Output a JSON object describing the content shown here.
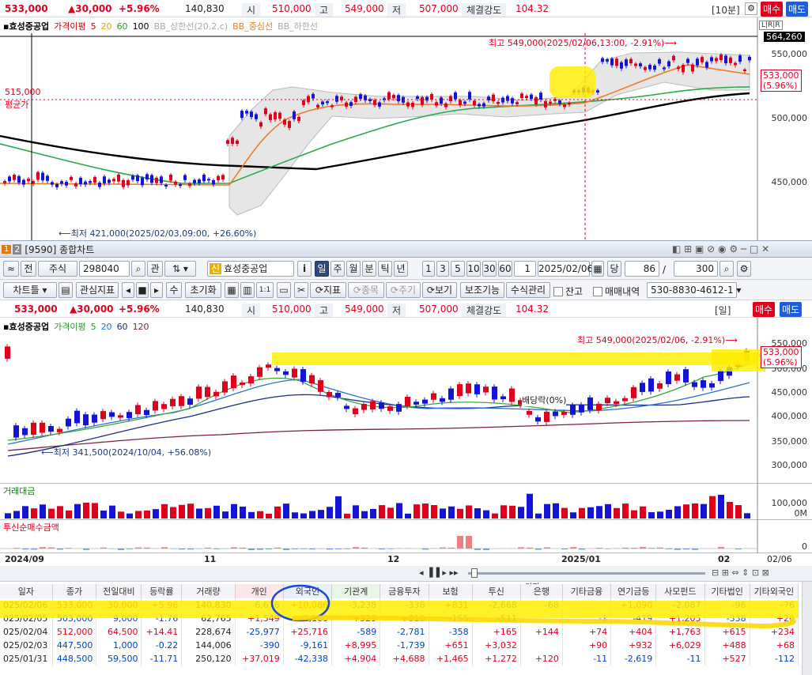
{
  "top_quote": {
    "price": "533,000",
    "change": "▲30,000",
    "pct": "+5.96%",
    "volume": "140,830",
    "open_label": "시",
    "open": "510,000",
    "high_label": "고",
    "high": "549,000",
    "low_label": "저",
    "low": "507,000",
    "strength_label": "체결강도",
    "strength": "104.32",
    "period": "[10분]",
    "buy": "매수",
    "sell": "매도"
  },
  "top_chart": {
    "legend": [
      "효성중공업",
      "가격이평",
      "5",
      "20",
      "60",
      "100",
      "BB_상한선(20,2,c)",
      "BB_중심선",
      "BB_하한선"
    ],
    "axis": [
      "550,000",
      "500,000",
      "450,000"
    ],
    "current_box": "564,260",
    "price_tag": "533,000",
    "price_tag_pct": "(5.96%)",
    "high_note": "최고 549,000(2025/02/06,13:00, -2.91%)⟶",
    "low_note": "⟵최저 421,000(2025/02/03,09:00, +26.60%)",
    "avg_price": "515,000",
    "avg_label": "평균가",
    "lr_label": "L|R|R"
  },
  "window": {
    "badge": "1",
    "title": "[9590] 종합차트"
  },
  "toolbar1": {
    "jeon": "전",
    "market": "주식",
    "code": "298040",
    "gwan": "관",
    "new_tag": "신",
    "name": "효성중공업",
    "info": "i",
    "periods": [
      "일",
      "주",
      "월",
      "분",
      "틱",
      "년"
    ],
    "intervals": [
      "1",
      "3",
      "5",
      "10",
      "30",
      "60"
    ],
    "count_val": "1",
    "date": "2025/02/06",
    "dang": "당",
    "bars": "86",
    "slash": "/",
    "total": "300"
  },
  "toolbar2": {
    "chart_type": "차트틀",
    "watch": "관심지표",
    "su": "수",
    "reset": "초기화",
    "ratio": "1:1",
    "indicator": "지표",
    "item": "종목",
    "cycle": "주기",
    "view": "보기",
    "assist": "보조기능",
    "formula": "수식관리",
    "balance": "잔고",
    "trade_hist": "매매내역",
    "account": "530-8830-4612-1"
  },
  "quote2": {
    "price": "533,000",
    "change": "▲30,000",
    "pct": "+5.96%",
    "volume": "140,830",
    "open_label": "시",
    "open": "510,000",
    "high_label": "고",
    "high": "549,000",
    "low_label": "저",
    "low": "507,000",
    "strength_label": "체결강도",
    "strength": "104.32",
    "period": "[일]",
    "buy": "매수",
    "sell": "매도"
  },
  "main_chart": {
    "legend": [
      "효성중공업",
      "가격이평",
      "5",
      "20",
      "60",
      "120"
    ],
    "axis": [
      "550,000",
      "500,000",
      "450,000",
      "400,000",
      "350,000",
      "300,000"
    ],
    "high_note": "최고 549,000(2025/02/06, -2.91%)⟶",
    "low_note": "⟵최저 341,500(2024/10/04, +56.08%)",
    "dividend": "배당락(0%)",
    "price_tag": "533,000",
    "price_tag_pct": "(5.96%)"
  },
  "volume_panel": {
    "title": "거래대금",
    "axis": [
      "100,000",
      "0M"
    ]
  },
  "trust_panel": {
    "title": "투신순매수금액",
    "axis": [
      "0"
    ]
  },
  "x_axis": [
    "2024/09",
    "11",
    "12",
    "2025/01",
    "02",
    "02/06"
  ],
  "colors": {
    "up": "#e0001b",
    "down": "#1414d8",
    "highlight": "#ffee00",
    "ma5": "#3aa83a",
    "ma20": "#2a72d0",
    "ma60": "#1a2a8a",
    "ma120": "#7a1f4a",
    "bb_mid": "#f07a20",
    "ma100": "#000000"
  },
  "table": {
    "headers": [
      "일자",
      "종가",
      "전일대비",
      "등락률",
      "거래량",
      "개인",
      "외국인",
      "기관계",
      "금융투자",
      "보험",
      "투신",
      "은행",
      "기타금융",
      "연기금등",
      "사모펀드",
      "기타법인",
      "기타외국인"
    ],
    "group_label": "기관",
    "rows": [
      [
        "025/02/06",
        "533,000",
        "30,000",
        "+5.96",
        "140,830",
        "-6,676",
        "+10,086",
        "-3,238",
        "-336",
        "+831",
        "-2,668",
        "-68",
        "",
        "+1,090",
        "-2,087",
        "-96",
        "-76"
      ],
      [
        "025/02/05",
        "503,000",
        "9,000",
        "-1.76",
        "62,765",
        "+1,549",
        "-2,160",
        "+929",
        "+810",
        "-155",
        "-511",
        "",
        "-1",
        "-419",
        "+1,205",
        "-338",
        "+20"
      ],
      [
        "025/02/04",
        "512,000",
        "64,500",
        "+14.41",
        "228,674",
        "-25,977",
        "+25,716",
        "-589",
        "-2,781",
        "-358",
        "+165",
        "+144",
        "+74",
        "+404",
        "+1,763",
        "+615",
        "+234"
      ],
      [
        "025/02/03",
        "447,500",
        "1,000",
        "-0.22",
        "144,006",
        "-390",
        "-9,161",
        "+8,995",
        "-1,739",
        "+651",
        "+3,032",
        "",
        "+90",
        "+932",
        "+6,029",
        "+488",
        "+68"
      ],
      [
        "025/01/31",
        "448,500",
        "59,500",
        "-11.71",
        "250,120",
        "+37,019",
        "-42,338",
        "+4,904",
        "+4,688",
        "+1,465",
        "+1,272",
        "+120",
        "-11",
        "-2,619",
        "-11",
        "+527",
        "-112"
      ]
    ]
  }
}
